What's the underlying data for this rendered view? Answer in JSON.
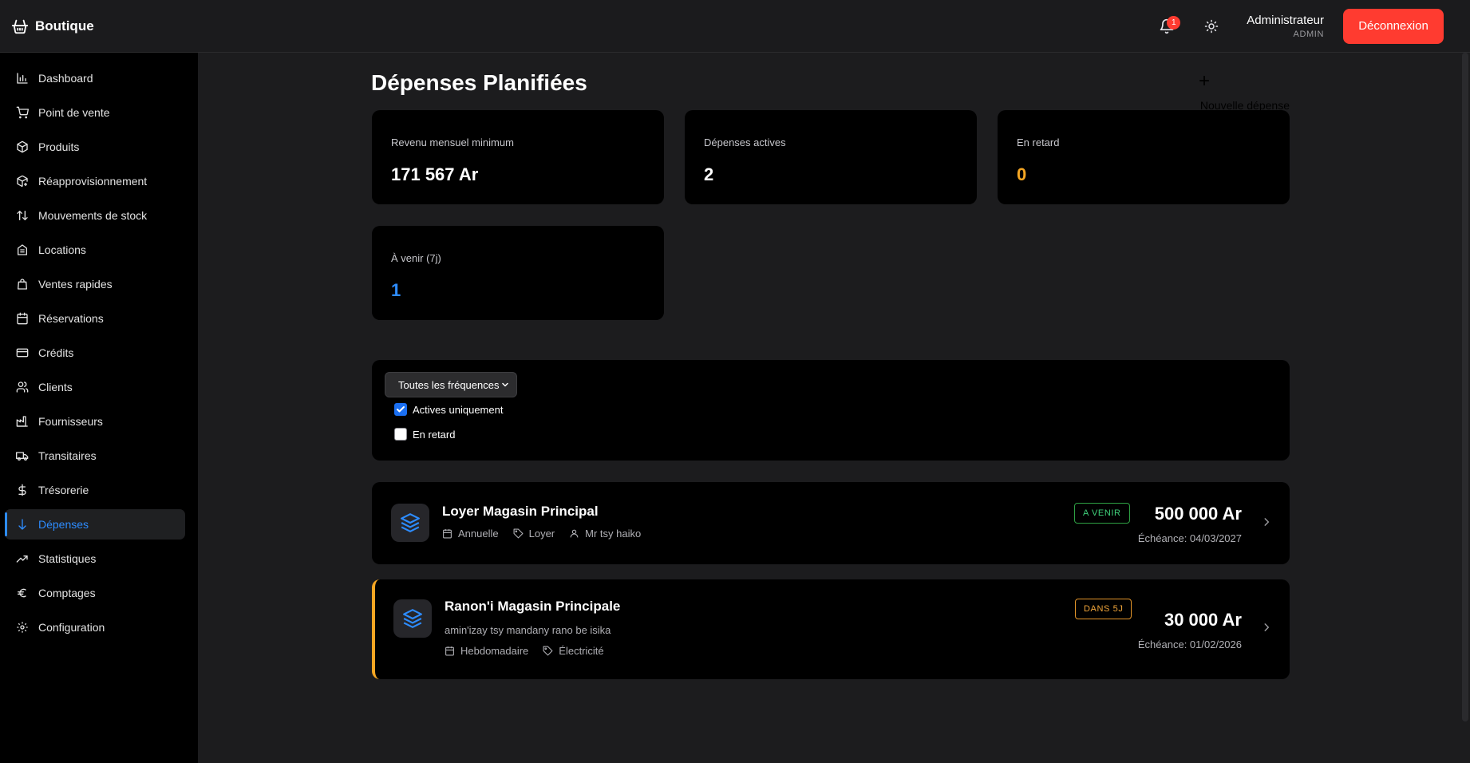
{
  "brand": {
    "name": "Boutique",
    "icon": "basket-icon"
  },
  "header": {
    "notifications": {
      "icon": "bell-icon",
      "count": "1"
    },
    "theme_toggle_icon": "sun-icon",
    "user": {
      "name": "Administrateur",
      "role": "ADMIN"
    },
    "logout_label": "Déconnexion"
  },
  "sidebar": {
    "items": [
      {
        "label": "Dashboard",
        "icon": "chart-bars-icon"
      },
      {
        "label": "Point de vente",
        "icon": "cart-icon"
      },
      {
        "label": "Produits",
        "icon": "package-icon"
      },
      {
        "label": "Réapprovisionnement",
        "icon": "package-plus-icon"
      },
      {
        "label": "Mouvements de stock",
        "icon": "arrows-up-down-icon"
      },
      {
        "label": "Locations",
        "icon": "building-icon"
      },
      {
        "label": "Ventes rapides",
        "icon": "shopping-bag-icon"
      },
      {
        "label": "Réservations",
        "icon": "calendar-icon"
      },
      {
        "label": "Crédits",
        "icon": "credit-card-icon"
      },
      {
        "label": "Clients",
        "icon": "users-icon"
      },
      {
        "label": "Fournisseurs",
        "icon": "factory-icon"
      },
      {
        "label": "Transitaires",
        "icon": "truck-icon"
      },
      {
        "label": "Trésorerie",
        "icon": "dollar-icon"
      },
      {
        "label": "Dépenses",
        "icon": "arrow-down-icon",
        "active": true
      },
      {
        "label": "Statistiques",
        "icon": "trending-up-icon"
      },
      {
        "label": "Comptages",
        "icon": "euro-icon"
      },
      {
        "label": "Configuration",
        "icon": "gear-icon"
      }
    ]
  },
  "page": {
    "title": "Dépenses Planifiées",
    "new_button": {
      "icon": "plus-icon",
      "label": "Nouvelle dépense"
    }
  },
  "stats": [
    {
      "label": "Revenu mensuel minimum",
      "value": "171 567 Ar",
      "color": "#ffffff"
    },
    {
      "label": "Dépenses actives",
      "value": "2",
      "color": "#ffffff"
    },
    {
      "label": "En retard",
      "value": "0",
      "color": "#f5a623"
    },
    {
      "label": "À venir (7j)",
      "value": "1",
      "color": "#2d8cff"
    }
  ],
  "filters": {
    "frequency_select": "Toutes les fréquences",
    "active_only": {
      "label": "Actives uniquement",
      "checked": true
    },
    "late": {
      "label": "En retard",
      "checked": false
    }
  },
  "expenses": [
    {
      "title": "Loyer Magasin Principal",
      "description": "",
      "frequency": "Annuelle",
      "category": "Loyer",
      "person": "Mr tsy haiko",
      "status": "A VENIR",
      "amount": "500 000 Ar",
      "due": "Échéance: 04/03/2027"
    },
    {
      "title": "Ranon'i Magasin Principale",
      "description": "amin'izay tsy mandany rano be isika",
      "frequency": "Hebdomadaire",
      "category": "Électricité",
      "person": "",
      "status": "DANS 5J",
      "amount": "30 000 Ar",
      "due": "Échéance: 01/02/2026"
    }
  ],
  "colors": {
    "accent": "#2d8cff",
    "danger": "#ff3b30",
    "warning": "#f5a623",
    "success": "#3fd07a"
  }
}
